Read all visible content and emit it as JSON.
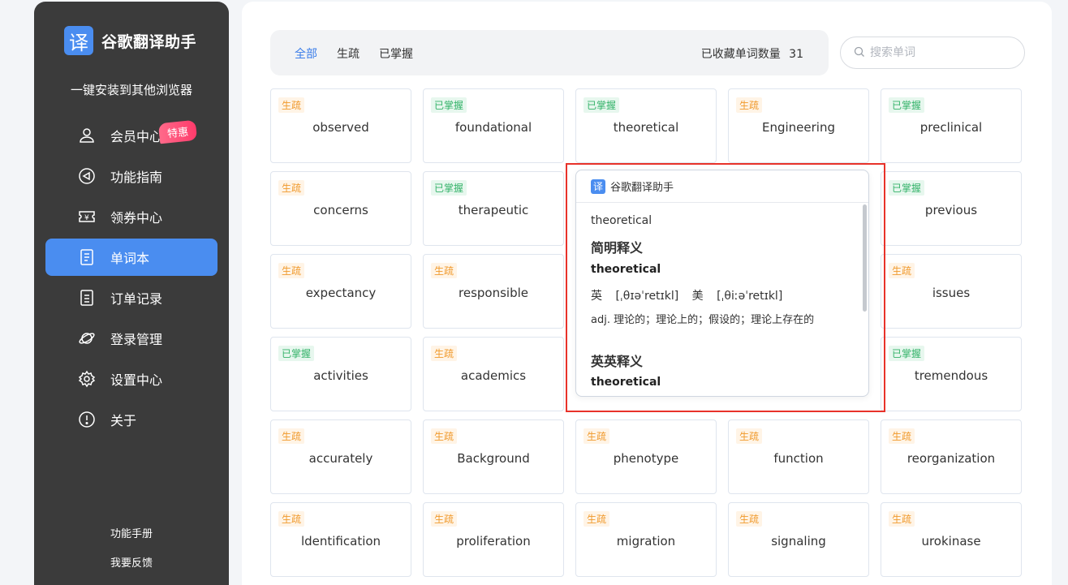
{
  "app": {
    "logo_char": "译",
    "name": "谷歌翻译助手",
    "install_text": "一键安装到其他浏览器"
  },
  "sidebar": {
    "items": [
      {
        "label": "会员中心",
        "icon": "user-icon",
        "badge": "特惠"
      },
      {
        "label": "功能指南",
        "icon": "send-icon"
      },
      {
        "label": "领券中心",
        "icon": "coupon-icon"
      },
      {
        "label": "单词本",
        "icon": "wordbook-icon",
        "active": true
      },
      {
        "label": "订单记录",
        "icon": "order-icon"
      },
      {
        "label": "登录管理",
        "icon": "planet-icon"
      },
      {
        "label": "设置中心",
        "icon": "gear-icon"
      },
      {
        "label": "关于",
        "icon": "info-icon"
      }
    ],
    "manual": "功能手册",
    "feedback": "我要反馈"
  },
  "tabs": {
    "all": "全部",
    "weak": "生疏",
    "known": "已掌握",
    "count_label": "已收藏单词数量",
    "count": "31"
  },
  "search": {
    "placeholder": "搜索单词"
  },
  "colors": {
    "accent": "#4a8df0",
    "weak_tag": "#f09a2d",
    "known_tag": "#35b36a",
    "highlight": "#e8322a"
  },
  "cards": [
    {
      "tag": "生疏",
      "word": "observed"
    },
    {
      "tag": "已掌握",
      "word": "foundational"
    },
    {
      "tag": "已掌握",
      "word": "theoretical"
    },
    {
      "tag": "生疏",
      "word": "Engineering"
    },
    {
      "tag": "已掌握",
      "word": "preclinical"
    },
    {
      "tag": "生疏",
      "word": "concerns"
    },
    {
      "tag": "已掌握",
      "word": "therapeutic"
    },
    {
      "tag": "已掌握",
      "word": "previous"
    },
    {
      "tag": "生疏",
      "word": "expectancy"
    },
    {
      "tag": "生疏",
      "word": "responsible"
    },
    {
      "tag": "生疏",
      "word": "issues"
    },
    {
      "tag": "已掌握",
      "word": "activities"
    },
    {
      "tag": "生疏",
      "word": "academics"
    },
    {
      "tag": "已掌握",
      "word": "tremendous"
    },
    {
      "tag": "生疏",
      "word": "accurately"
    },
    {
      "tag": "生疏",
      "word": "Background"
    },
    {
      "tag": "生疏",
      "word": "phenotype"
    },
    {
      "tag": "生疏",
      "word": "function"
    },
    {
      "tag": "生疏",
      "word": "reorganization"
    },
    {
      "tag": "生疏",
      "word": "ldentification"
    },
    {
      "tag": "生疏",
      "word": "proliferation"
    },
    {
      "tag": "生疏",
      "word": "migration"
    },
    {
      "tag": "生疏",
      "word": "signaling"
    },
    {
      "tag": "生疏",
      "word": "urokinase"
    }
  ],
  "popup": {
    "title": "谷歌翻译助手",
    "word": "theoretical",
    "brief_heading": "简明释义",
    "brief_word": "theoretical",
    "phonetic_uk_label": "英",
    "phonetic_uk": "[ˌθɪəˈretɪkl]",
    "phonetic_us_label": "美",
    "phonetic_us": "[ˌθiːəˈretɪkl]",
    "definition": "adj. 理论的；理论上的；假设的；理论上存在的",
    "en_heading": "英英释义",
    "en_word": "theoretical"
  }
}
